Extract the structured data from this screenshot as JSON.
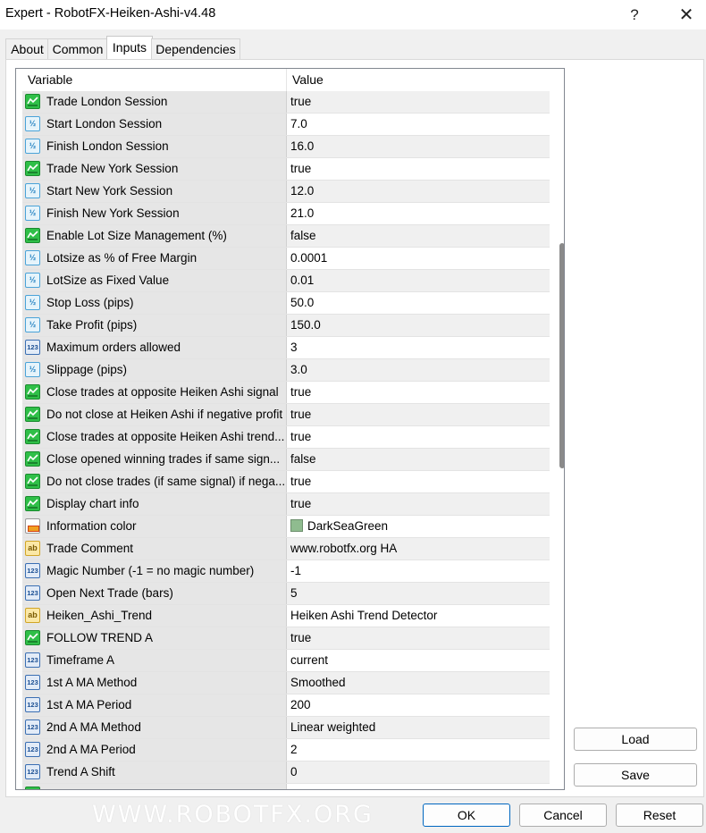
{
  "window": {
    "title": "Expert - RobotFX-Heiken-Ashi-v4.48",
    "help_glyph": "?",
    "close_glyph": "✕"
  },
  "tabs": [
    {
      "label": "About",
      "active": false
    },
    {
      "label": "Common",
      "active": false
    },
    {
      "label": "Inputs",
      "active": true
    },
    {
      "label": "Dependencies",
      "active": false
    }
  ],
  "grid": {
    "headers": {
      "variable": "Variable",
      "value": "Value"
    },
    "rows": [
      {
        "type": "bool",
        "variable": "Trade London Session",
        "value": "true"
      },
      {
        "type": "double",
        "variable": "Start London Session",
        "value": "7.0"
      },
      {
        "type": "double",
        "variable": "Finish London Session",
        "value": "16.0"
      },
      {
        "type": "bool",
        "variable": "Trade New York Session",
        "value": "true"
      },
      {
        "type": "double",
        "variable": "Start New York Session",
        "value": "12.0"
      },
      {
        "type": "double",
        "variable": "Finish New York Session",
        "value": "21.0"
      },
      {
        "type": "bool",
        "variable": "Enable Lot Size Management (%)",
        "value": "false"
      },
      {
        "type": "double",
        "variable": "Lotsize as % of Free Margin",
        "value": "0.0001"
      },
      {
        "type": "double",
        "variable": "LotSize as Fixed Value",
        "value": "0.01"
      },
      {
        "type": "double",
        "variable": "Stop Loss (pips)",
        "value": "50.0"
      },
      {
        "type": "double",
        "variable": "Take Profit (pips)",
        "value": "150.0"
      },
      {
        "type": "int",
        "variable": "Maximum orders allowed",
        "value": "3"
      },
      {
        "type": "double",
        "variable": "Slippage (pips)",
        "value": "3.0"
      },
      {
        "type": "bool",
        "variable": "Close trades at opposite Heiken Ashi signal",
        "value": "true"
      },
      {
        "type": "bool",
        "variable": "Do not close at Heiken Ashi if negative profit",
        "value": "true"
      },
      {
        "type": "bool",
        "variable": "Close trades at opposite Heiken Ashi trend...",
        "value": "true"
      },
      {
        "type": "bool",
        "variable": "Close opened winning trades if same sign...",
        "value": "false"
      },
      {
        "type": "bool",
        "variable": "Do not close trades (if same signal) if nega...",
        "value": "true"
      },
      {
        "type": "bool",
        "variable": "Display chart info",
        "value": "true"
      },
      {
        "type": "color",
        "variable": "Information color",
        "value": "DarkSeaGreen",
        "swatch": "#8fbc8f"
      },
      {
        "type": "string",
        "variable": "Trade Comment",
        "value": "www.robotfx.org HA"
      },
      {
        "type": "int",
        "variable": "Magic Number (-1 = no magic number)",
        "value": "-1"
      },
      {
        "type": "int",
        "variable": "Open Next Trade (bars)",
        "value": "5"
      },
      {
        "type": "string",
        "variable": "Heiken_Ashi_Trend",
        "value": "Heiken Ashi Trend Detector"
      },
      {
        "type": "bool",
        "variable": "FOLLOW TREND A",
        "value": "true"
      },
      {
        "type": "int",
        "variable": "Timeframe A",
        "value": "current"
      },
      {
        "type": "int",
        "variable": "1st A MA Method",
        "value": "Smoothed"
      },
      {
        "type": "int",
        "variable": "1st A MA Period",
        "value": "200"
      },
      {
        "type": "int",
        "variable": "2nd A MA Method",
        "value": "Linear weighted"
      },
      {
        "type": "int",
        "variable": "2nd A MA Period",
        "value": "2"
      },
      {
        "type": "int",
        "variable": "Trend A Shift",
        "value": "0"
      },
      {
        "type": "bool",
        "variable": "",
        "value": ""
      }
    ]
  },
  "icons": {
    "bool": {
      "name": "bool-icon",
      "glyph": ""
    },
    "double": {
      "name": "double-icon",
      "glyph": "½"
    },
    "int": {
      "name": "integer-icon",
      "glyph": "123"
    },
    "string": {
      "name": "string-icon",
      "glyph": "ab"
    },
    "color": {
      "name": "color-icon",
      "glyph": ""
    }
  },
  "buttons": {
    "load": "Load",
    "save": "Save",
    "ok": "OK",
    "cancel": "Cancel",
    "reset": "Reset"
  },
  "watermark": "WWW.ROBOTFX.ORG",
  "colors": {
    "accent": "#0067c0",
    "swatch": "#8fbc8f"
  }
}
